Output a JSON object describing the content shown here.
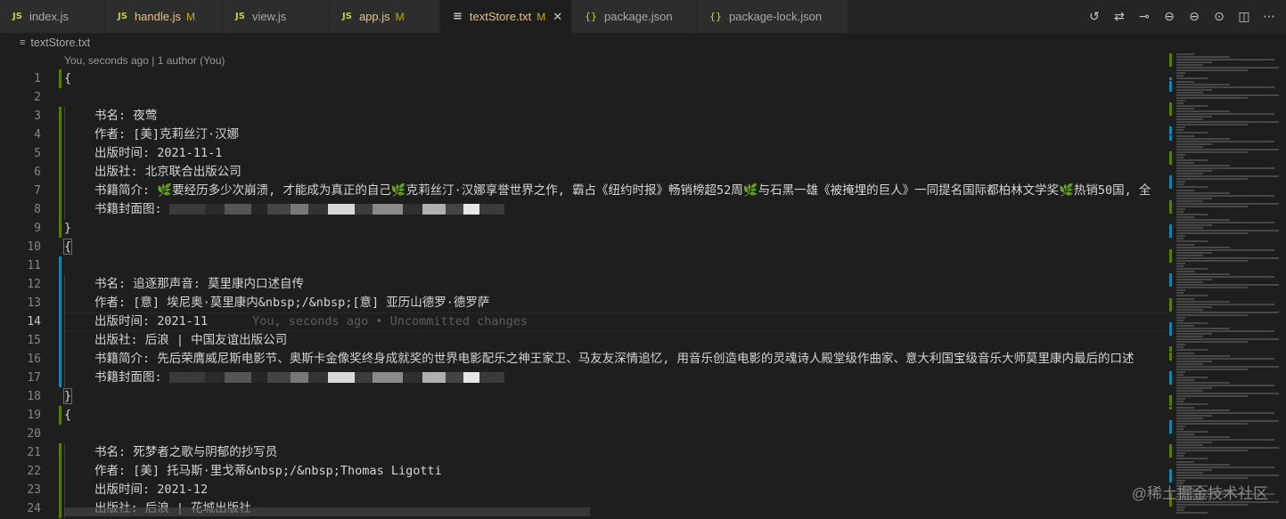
{
  "tabs": [
    {
      "icon": "JS",
      "label": "index.js",
      "modified": "",
      "active": false,
      "width": 118
    },
    {
      "icon": "JS",
      "label": "handle.js",
      "modified": "M",
      "active": false,
      "width": 132
    },
    {
      "icon": "JS",
      "label": "view.js",
      "modified": "",
      "active": false,
      "width": 120
    },
    {
      "icon": "JS",
      "label": "app.js",
      "modified": "M",
      "active": false,
      "width": 124
    },
    {
      "icon": "≡",
      "label": "textStore.txt",
      "modified": "M",
      "active": true,
      "width": 148
    },
    {
      "icon": "{}",
      "label": "package.json",
      "modified": "",
      "active": false,
      "width": 140
    },
    {
      "icon": "{}",
      "label": "package-lock.json",
      "modified": "",
      "active": false,
      "width": 170
    }
  ],
  "breadcrumb": {
    "file": "textStore.txt"
  },
  "codelens": "You, seconds ago | 1 author (You)",
  "blame": "You, seconds ago • Uncommitted changes",
  "current_line": 14,
  "lines": [
    {
      "n": "1",
      "text": "{",
      "indent": false,
      "mark": "added"
    },
    {
      "n": "2",
      "text": "",
      "indent": false,
      "mark": ""
    },
    {
      "n": "3",
      "text": "书名: 夜莺",
      "indent": true,
      "mark": "added"
    },
    {
      "n": "4",
      "text": "作者: [美]克莉丝汀·汉娜",
      "indent": true,
      "mark": "added"
    },
    {
      "n": "5",
      "text": "出版时间: 2021-11-1",
      "indent": true,
      "mark": "added"
    },
    {
      "n": "6",
      "text": "出版社: 北京联合出版公司",
      "indent": true,
      "mark": "added"
    },
    {
      "n": "7",
      "text": "书籍简介: 🌿要经历多少次崩溃, 才能成为真正的自己🌿克莉丝汀·汉娜享誉世界之作, 霸占《纽约时报》畅销榜超52周🌿与石黑一雄《被掩埋的巨人》一同提名国际都柏林文学奖🌿热销50国, 全",
      "indent": true,
      "mark": "added"
    },
    {
      "n": "8",
      "text": "书籍封面图:",
      "indent": true,
      "mark": "added",
      "blurred": true
    },
    {
      "n": "9",
      "text": "}",
      "indent": false,
      "mark": "added"
    },
    {
      "n": "10",
      "text": "{",
      "indent": false,
      "mark": ""
    },
    {
      "n": "11",
      "text": "",
      "indent": false,
      "mark": "modified"
    },
    {
      "n": "12",
      "text": "书名: 追逐那声音: 莫里康内口述自传",
      "indent": true,
      "mark": "modified"
    },
    {
      "n": "13",
      "text": "作者: [意] 埃尼奥·莫里康内&nbsp;/&nbsp;[意] 亚历山德罗·德罗萨",
      "indent": true,
      "mark": "modified"
    },
    {
      "n": "14",
      "text": "出版时间: 2021-11",
      "indent": true,
      "mark": "modified"
    },
    {
      "n": "15",
      "text": "出版社: 后浪 | 中国友谊出版公司",
      "indent": true,
      "mark": "modified"
    },
    {
      "n": "16",
      "text": "书籍简介: 先后荣膺威尼斯电影节、奥斯卡金像奖终身成就奖的世界电影配乐之神王家卫、马友友深情追忆, 用音乐创造电影的灵魂诗人殿堂级作曲家、意大利国宝级音乐大师莫里康内最后的口述",
      "indent": true,
      "mark": "modified"
    },
    {
      "n": "17",
      "text": "书籍封面图:",
      "indent": true,
      "mark": "modified",
      "blurred": true
    },
    {
      "n": "18",
      "text": "}",
      "indent": false,
      "mark": ""
    },
    {
      "n": "19",
      "text": "{",
      "indent": false,
      "mark": "added"
    },
    {
      "n": "20",
      "text": "",
      "indent": false,
      "mark": ""
    },
    {
      "n": "21",
      "text": "书名: 死梦者之歌与阴郁的抄写员",
      "indent": true,
      "mark": "added"
    },
    {
      "n": "22",
      "text": "作者: [美] 托马斯·里戈蒂&nbsp;/&nbsp;Thomas Ligotti",
      "indent": true,
      "mark": "added"
    },
    {
      "n": "23",
      "text": "出版时间: 2021-12",
      "indent": true,
      "mark": "added"
    },
    {
      "n": "24",
      "text": "出版社: 后浪 | 花城出版社",
      "indent": true,
      "mark": "added"
    }
  ],
  "colors": {
    "added": "#587c0c",
    "modified": "#1b81a8"
  },
  "watermark": "@稀土掘金技术社区"
}
